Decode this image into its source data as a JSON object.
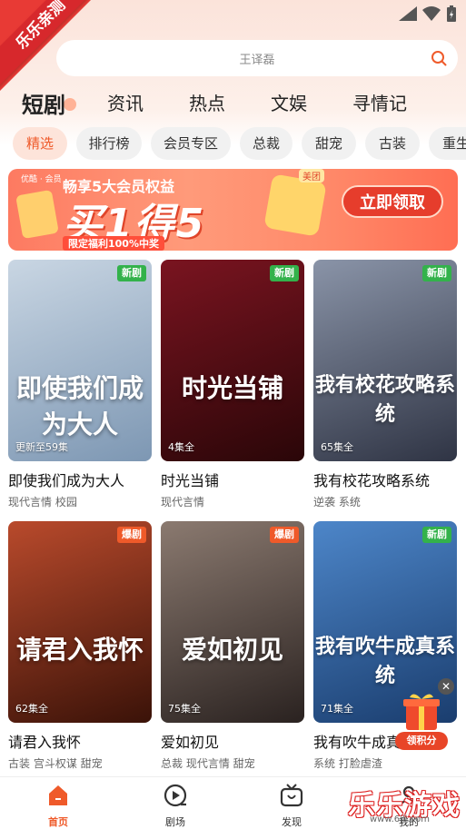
{
  "corner_badge": "乐乐亲测",
  "search": {
    "placeholder": "王译磊"
  },
  "tabs": [
    {
      "label": "短剧",
      "active": true
    },
    {
      "label": "资讯"
    },
    {
      "label": "热点"
    },
    {
      "label": "文娱"
    },
    {
      "label": "寻情记"
    }
  ],
  "chips": [
    {
      "label": "精选",
      "active": true
    },
    {
      "label": "排行榜"
    },
    {
      "label": "会员专区"
    },
    {
      "label": "总裁"
    },
    {
      "label": "甜宠"
    },
    {
      "label": "古装"
    },
    {
      "label": "重生"
    }
  ],
  "banner": {
    "brand": "优酷 · 会员",
    "top": "畅享5大会员权益",
    "main": "买1得5",
    "sub": "限定福利100%中奖",
    "button": "立即领取",
    "cap": "美团"
  },
  "cards": [
    {
      "title": "即使我们成为大人",
      "tags": "现代言情 校园",
      "ep": "更新至59集",
      "badge": "新剧",
      "badge_type": "new",
      "poster_text": "即使我们成为大人",
      "colors": [
        "#c9d6e3",
        "#7d97b3"
      ]
    },
    {
      "title": "时光当铺",
      "tags": "现代言情",
      "ep": "4集全",
      "badge": "新剧",
      "badge_type": "new",
      "poster_text": "时光当铺",
      "colors": [
        "#7a1420",
        "#2a0608"
      ]
    },
    {
      "title": "我有校花攻略系统",
      "tags": "逆袭 系统",
      "ep": "65集全",
      "badge": "新剧",
      "badge_type": "new",
      "poster_text": "我有校花攻略系统",
      "colors": [
        "#8a94a8",
        "#2f3444"
      ]
    },
    {
      "title": "请君入我怀",
      "tags": "古装 宫斗权谋 甜宠",
      "ep": "62集全",
      "badge": "爆剧",
      "badge_type": "hot",
      "poster_text": "请君入我怀",
      "colors": [
        "#b94a2c",
        "#3a1208"
      ]
    },
    {
      "title": "爱如初见",
      "tags": "总裁 现代言情 甜宠",
      "ep": "75集全",
      "badge": "爆剧",
      "badge_type": "hot",
      "poster_text": "爱如初见",
      "colors": [
        "#8b7a70",
        "#2a2220"
      ]
    },
    {
      "title": "我有吹牛成真系统",
      "tags": "系统 打脸虐渣",
      "ep": "71集全",
      "badge": "新剧",
      "badge_type": "new",
      "poster_text": "我有吹牛成真系统",
      "colors": [
        "#4d86c9",
        "#1a3d6e"
      ]
    }
  ],
  "floating": {
    "close": "✕",
    "points_label": "领积分"
  },
  "bottom_nav": [
    {
      "label": "首页",
      "icon": "home-icon",
      "active": true
    },
    {
      "label": "剧场",
      "icon": "play-circle-icon"
    },
    {
      "label": "发现",
      "icon": "tv-icon"
    },
    {
      "label": "我的",
      "icon": "user-icon"
    }
  ],
  "watermark": {
    "text": "乐乐游戏",
    "url": "www.6jll.com"
  },
  "colors": {
    "accent": "#ef5a2a",
    "new_badge": "#33b24b",
    "hot_badge": "#ef5a2a"
  }
}
